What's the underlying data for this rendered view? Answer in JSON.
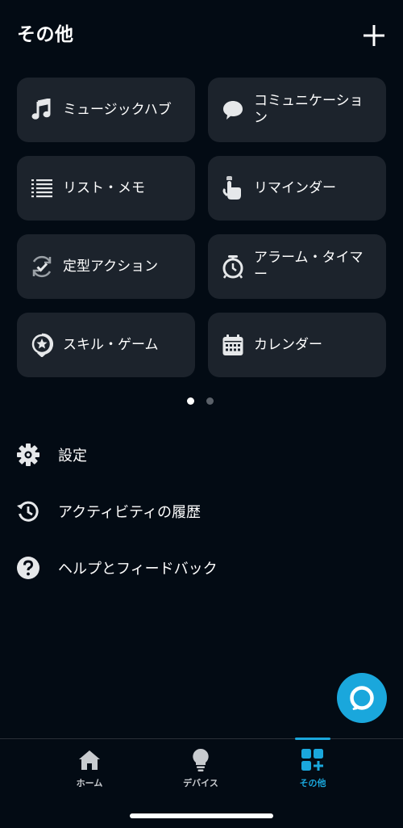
{
  "header": {
    "title": "その他",
    "add_icon": "plus-icon"
  },
  "cards": [
    {
      "label": "ミュージックハブ",
      "icon": "music-note-icon"
    },
    {
      "label": "コミュニケーション",
      "icon": "speech-bubble-icon"
    },
    {
      "label": "リスト・メモ",
      "icon": "list-icon"
    },
    {
      "label": "リマインダー",
      "icon": "finger-reminder-icon"
    },
    {
      "label": "定型アクション",
      "icon": "routine-check-icon"
    },
    {
      "label": "アラーム・タイマー",
      "icon": "alarm-clock-icon"
    },
    {
      "label": "スキル・ゲーム",
      "icon": "skill-star-icon"
    },
    {
      "label": "カレンダー",
      "icon": "calendar-icon"
    }
  ],
  "pager": {
    "current": 1,
    "total": 2
  },
  "menu": [
    {
      "label": "設定",
      "icon": "gear-icon"
    },
    {
      "label": "アクティビティの履歴",
      "icon": "history-icon"
    },
    {
      "label": "ヘルプとフィードバック",
      "icon": "help-icon"
    }
  ],
  "tabs": [
    {
      "label": "ホーム",
      "icon": "home-icon",
      "active": false
    },
    {
      "label": "デバイス",
      "icon": "lightbulb-icon",
      "active": false
    },
    {
      "label": "その他",
      "icon": "more-grid-icon",
      "active": true
    }
  ],
  "colors": {
    "background": "#030b14",
    "card": "#1c232c",
    "accent": "#1aa7dc",
    "icon": "#e6e8ea",
    "inactive_tab": "#c8cbcf"
  }
}
